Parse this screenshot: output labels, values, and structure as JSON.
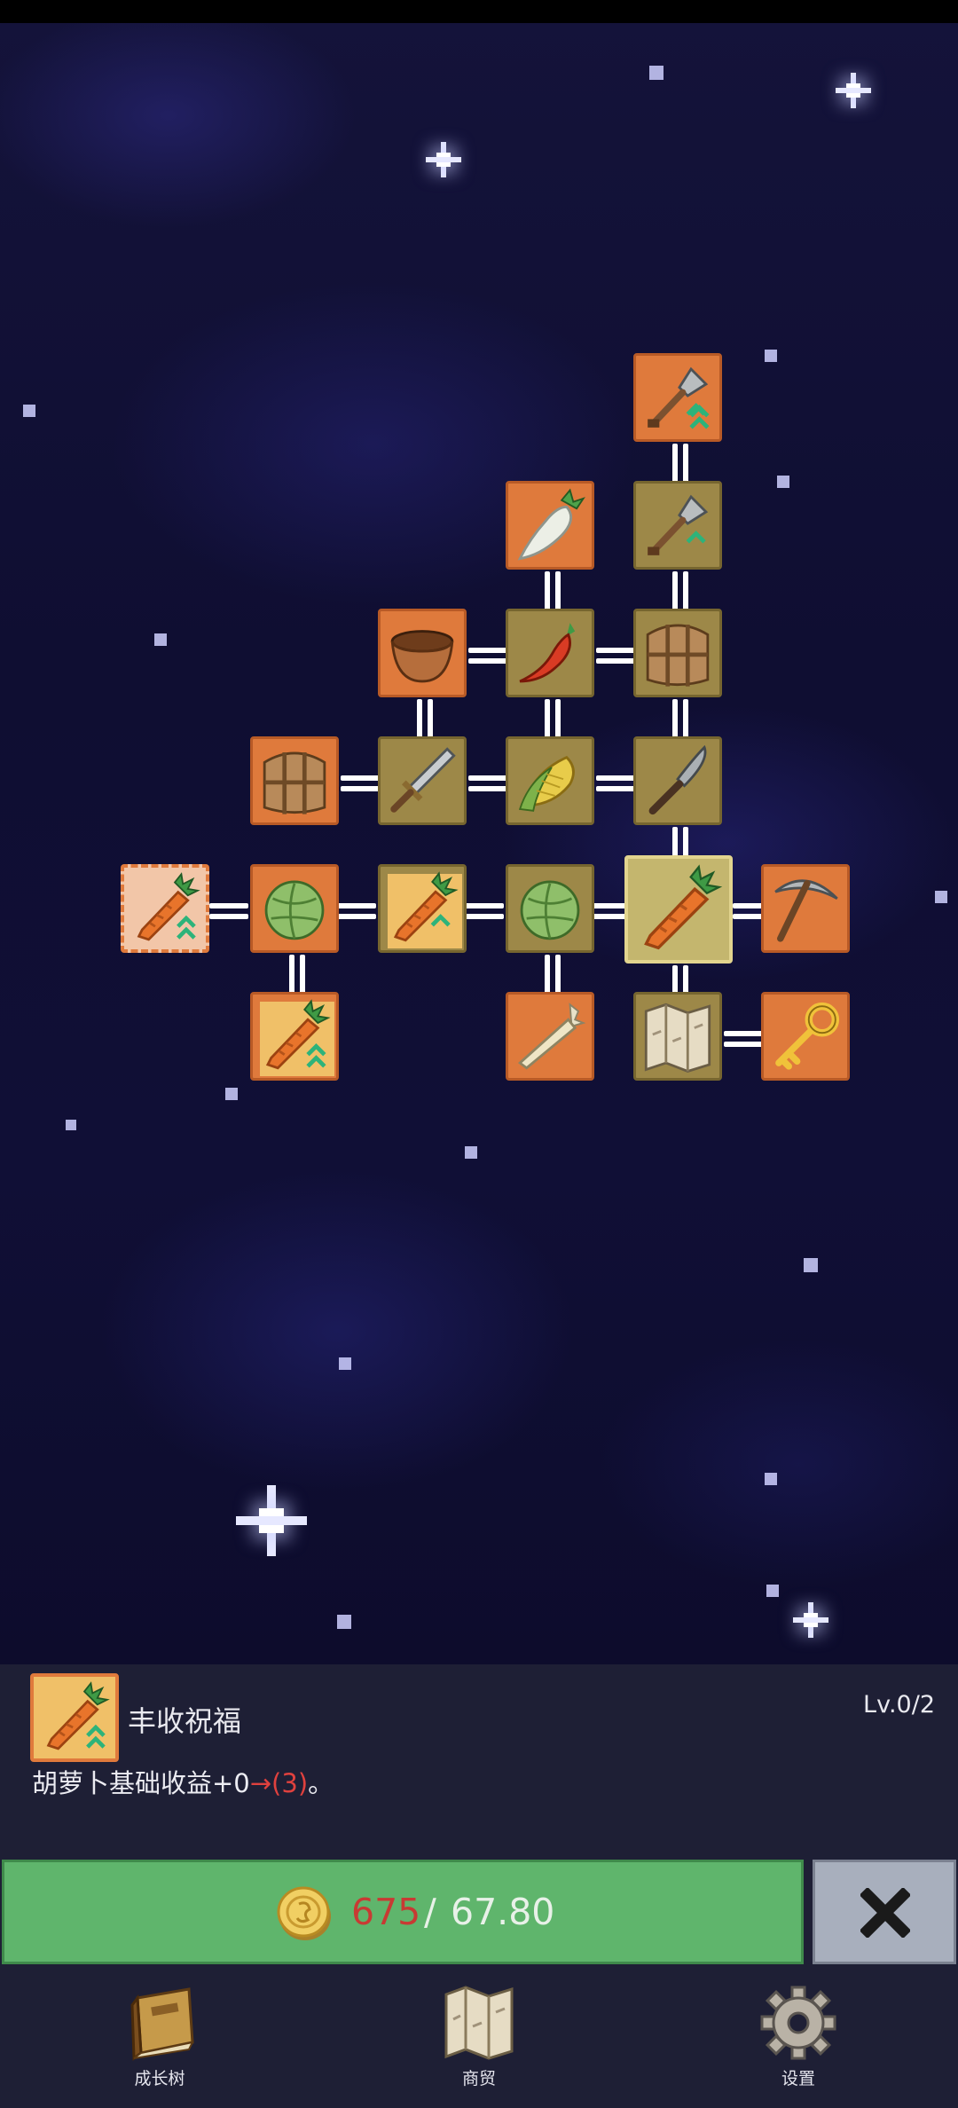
{
  "skill_tree": {
    "nodes": [
      {
        "id": "shovel-upgrade-2",
        "icon": "shovel-up-icon",
        "frame": "orange"
      },
      {
        "id": "radish",
        "icon": "radish-icon",
        "frame": "orange"
      },
      {
        "id": "shovel-upgrade-1",
        "icon": "shovel-up-icon",
        "frame": "olive"
      },
      {
        "id": "bowl",
        "icon": "bowl-icon",
        "frame": "orange"
      },
      {
        "id": "chili",
        "icon": "chili-icon",
        "frame": "olive"
      },
      {
        "id": "sack-1",
        "icon": "sack-icon",
        "frame": "olive"
      },
      {
        "id": "sack-2",
        "icon": "sack-icon",
        "frame": "orange"
      },
      {
        "id": "sword",
        "icon": "sword-icon",
        "frame": "olive"
      },
      {
        "id": "corn",
        "icon": "corn-icon",
        "frame": "olive"
      },
      {
        "id": "knife",
        "icon": "knife-icon",
        "frame": "olive"
      },
      {
        "id": "carrot-blessing-start",
        "icon": "carrot-up-icon",
        "frame": "start"
      },
      {
        "id": "cabbage-1",
        "icon": "cabbage-icon",
        "frame": "orange"
      },
      {
        "id": "carrot-up-a",
        "icon": "carrot-up-icon",
        "frame": "olive"
      },
      {
        "id": "cabbage-2",
        "icon": "cabbage-icon",
        "frame": "olive"
      },
      {
        "id": "carrot-selected",
        "icon": "carrot-icon",
        "frame": "selected"
      },
      {
        "id": "pickaxe",
        "icon": "pickaxe-icon",
        "frame": "orange"
      },
      {
        "id": "carrot-up-b",
        "icon": "carrot-up-icon",
        "frame": "orange"
      },
      {
        "id": "parsnip",
        "icon": "parsnip-icon",
        "frame": "orange"
      },
      {
        "id": "map",
        "icon": "map-icon",
        "frame": "olive"
      },
      {
        "id": "key",
        "icon": "key-icon",
        "frame": "orange"
      }
    ]
  },
  "detail": {
    "name": "丰收祝福",
    "level": "Lv.0/2",
    "desc_prefix": "胡萝卜基础收益+0",
    "desc_change": "→(3)",
    "desc_suffix": "。",
    "icon": "carrot-up-icon"
  },
  "purchase": {
    "cost": "675",
    "separator": "/",
    "coins": "67.80",
    "coin_icon": "gold-coin-icon",
    "close_icon": "close-x-icon"
  },
  "nav": [
    {
      "label": "成长树",
      "icon": "book-icon"
    },
    {
      "label": "商贸",
      "icon": "map-icon"
    },
    {
      "label": "设置",
      "icon": "gear-icon"
    }
  ],
  "colors": {
    "tile_orange": "#df7a3c",
    "tile_olive": "#9d8848",
    "tile_selected": "#c4b66e",
    "buy_green": "#5fb56c",
    "cost_red": "#c83a33",
    "panel": "#1e1f35"
  }
}
